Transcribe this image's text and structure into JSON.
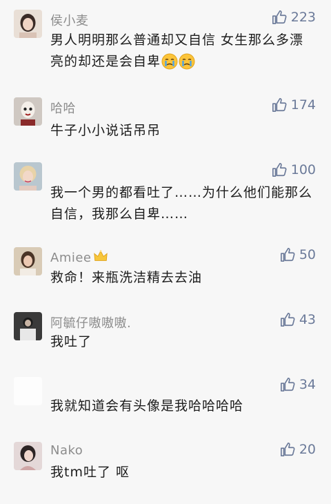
{
  "comments": [
    {
      "username": "侯小麦",
      "text": "男人明明那么普通却又自信  女生那么多漂亮的却还是会自卑",
      "likes": "223",
      "emojis": [
        "crying-face",
        "crying-face"
      ]
    },
    {
      "username": "哈哈",
      "text": "牛子小小说话吊吊",
      "likes": "174"
    },
    {
      "username": "",
      "text": "我一个男的都看吐了……为什么他们能那么自信，我那么自卑……",
      "likes": "100"
    },
    {
      "username": "Amiee",
      "text": "救命！来瓶洗洁精去去油",
      "likes": "50",
      "badge": "crown-icon"
    },
    {
      "username": "阿毓仔嗷嗷嗷.",
      "text": "我吐了",
      "likes": "43"
    },
    {
      "username": "",
      "text": "我就知道会有头像是我哈哈哈哈",
      "likes": "34"
    },
    {
      "username": "Nako",
      "text": "我tm吐了  呕",
      "likes": "20"
    }
  ],
  "colors": {
    "like": "#6b7a99",
    "username": "#8c8c8c",
    "text": "#1c1c1c",
    "background": "#f7f7f7"
  }
}
